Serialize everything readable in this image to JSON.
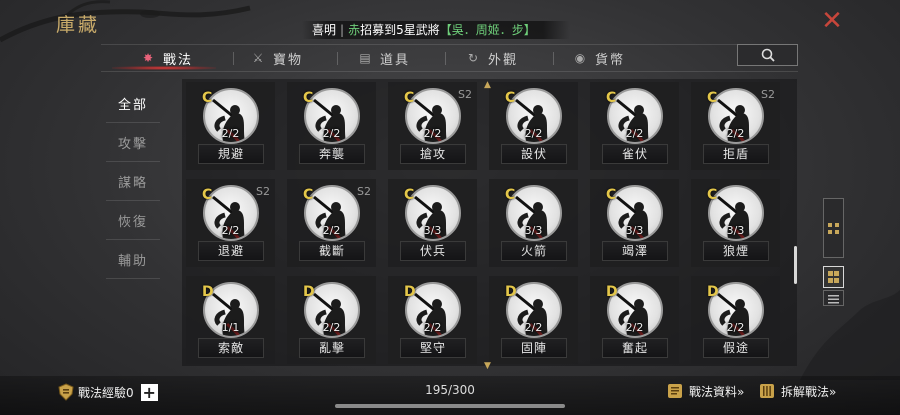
{
  "title": "庫藏",
  "marquee": {
    "p1": "喜明",
    "sep": "|",
    "p2": "赤",
    "p3": "招募到5星武將",
    "p4": "【吳．周姬．步】"
  },
  "search_icon": "search-icon",
  "tabs": [
    {
      "label": "戰法",
      "icon": "tactic-icon",
      "active": true
    },
    {
      "label": "寶物",
      "icon": "treasure-icon"
    },
    {
      "label": "道具",
      "icon": "item-icon"
    },
    {
      "label": "外觀",
      "icon": "appearance-icon"
    },
    {
      "label": "貨幣",
      "icon": "currency-icon"
    }
  ],
  "categories": [
    {
      "label": "全部",
      "active": true
    },
    {
      "label": "攻擊"
    },
    {
      "label": "謀略"
    },
    {
      "label": "恢復"
    },
    {
      "label": "輔助"
    }
  ],
  "cards": [
    {
      "grade": "C",
      "season": "",
      "count": "2/2",
      "name": "規避"
    },
    {
      "grade": "C",
      "season": "",
      "count": "2/2",
      "name": "奔襲"
    },
    {
      "grade": "C",
      "season": "S2",
      "count": "2/2",
      "name": "搶攻"
    },
    {
      "grade": "C",
      "season": "",
      "count": "2/2",
      "name": "設伏"
    },
    {
      "grade": "C",
      "season": "",
      "count": "2/2",
      "name": "雀伏"
    },
    {
      "grade": "C",
      "season": "S2",
      "count": "2/2",
      "name": "拒盾"
    },
    {
      "grade": "C",
      "season": "S2",
      "count": "2/2",
      "name": "退避"
    },
    {
      "grade": "C",
      "season": "S2",
      "count": "2/2",
      "name": "截斷"
    },
    {
      "grade": "C",
      "season": "",
      "count": "3/3",
      "name": "伏兵"
    },
    {
      "grade": "C",
      "season": "",
      "count": "3/3",
      "name": "火箭"
    },
    {
      "grade": "C",
      "season": "",
      "count": "3/3",
      "name": "竭澤"
    },
    {
      "grade": "C",
      "season": "",
      "count": "3/3",
      "name": "狼煙"
    },
    {
      "grade": "D",
      "season": "",
      "count": "1/1",
      "name": "索敵"
    },
    {
      "grade": "D",
      "season": "",
      "count": "2/2",
      "name": "亂擊"
    },
    {
      "grade": "D",
      "season": "",
      "count": "2/2",
      "name": "堅守"
    },
    {
      "grade": "D",
      "season": "",
      "count": "2/2",
      "name": "固陣"
    },
    {
      "grade": "D",
      "season": "",
      "count": "2/2",
      "name": "奮起"
    },
    {
      "grade": "D",
      "season": "",
      "count": "2/2",
      "name": "假途"
    }
  ],
  "footer": {
    "exp_label": "戰法經驗0",
    "plus": "+",
    "count": "195/300",
    "info_link": "戰法資料»",
    "dismantle_link": "拆解戰法»"
  },
  "colors": {
    "grade": "#e4c74a",
    "title": "#c9ab6a",
    "close": "#c7463b",
    "highlight": "#6fcf7a"
  }
}
